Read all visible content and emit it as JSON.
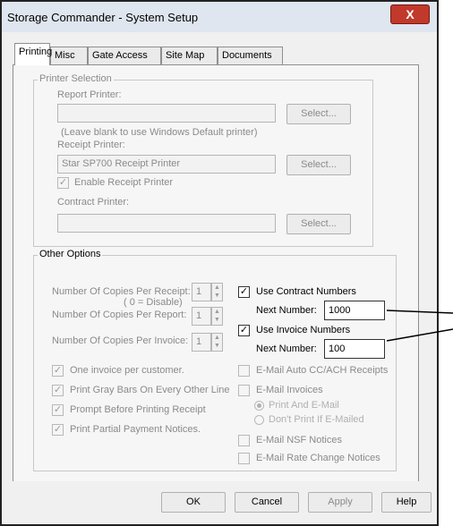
{
  "window": {
    "title": "Storage Commander - System Setup",
    "close_label": "X"
  },
  "tabs": [
    "Printing",
    "Misc",
    "Gate Access",
    "Site Map",
    "Documents"
  ],
  "printer_selection": {
    "legend": "Printer Selection",
    "report_printer_label": "Report Printer:",
    "report_printer_value": "",
    "select_label": "Select...",
    "hint": "(Leave blank to use Windows Default printer)",
    "receipt_printer_label": "Receipt Printer:",
    "receipt_printer_value": "Star SP700 Receipt Printer",
    "enable_receipt_label": "Enable Receipt Printer",
    "contract_printer_label": "Contract Printer:",
    "contract_printer_value": ""
  },
  "other_options": {
    "legend": "Other Options",
    "copies_receipt_label": "Number Of Copies Per Receipt:",
    "copies_receipt_note": "( 0 = Disable)",
    "copies_receipt_value": "1",
    "copies_report_label": "Number Of Copies Per Report:",
    "copies_report_value": "1",
    "copies_invoice_label": "Number Of Copies Per Invoice:",
    "copies_invoice_value": "1",
    "use_contract_label": "Use Contract Numbers",
    "contract_next_label": "Next Number:",
    "contract_next_value": "1000",
    "use_invoice_label": "Use Invoice Numbers",
    "invoice_next_label": "Next Number:",
    "invoice_next_value": "100",
    "one_invoice_label": "One invoice per customer.",
    "gray_bars_label": "Print Gray Bars On Every Other Line",
    "prompt_label": "Prompt Before Printing Receipt",
    "partial_label": "Print Partial Payment Notices.",
    "email_auto_label": "E-Mail Auto CC/ACH Receipts",
    "email_invoices_label": "E-Mail Invoices",
    "print_and_email_label": "Print And E-Mail",
    "dont_print_label": "Don't Print If E-Mailed",
    "email_nsf_label": "E-Mail NSF Notices",
    "email_rate_label": "E-Mail Rate Change Notices",
    "check_mark": "✓"
  },
  "buttons": {
    "ok": "OK",
    "cancel": "Cancel",
    "apply": "Apply",
    "help": "Help"
  }
}
